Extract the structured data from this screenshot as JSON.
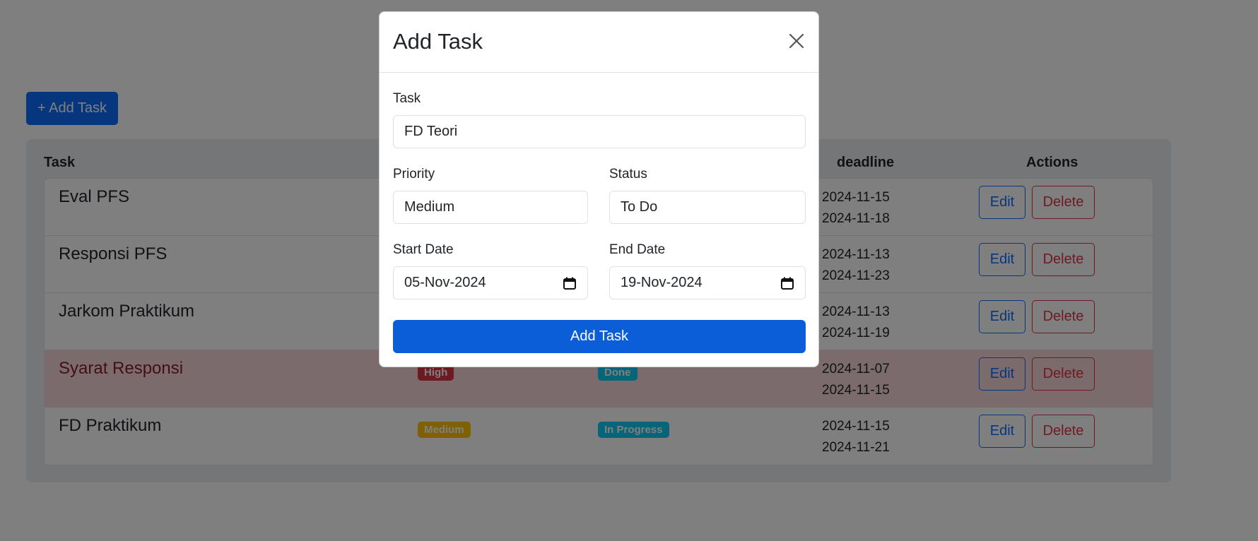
{
  "toolbar": {
    "add_task_label": "+ Add Task"
  },
  "table": {
    "columns": {
      "task": "Task",
      "deadline": "deadline",
      "actions": "Actions"
    },
    "edit_label": "Edit",
    "delete_label": "Delete",
    "rows": [
      {
        "task": "Eval PFS",
        "priority": "",
        "status": "",
        "start": "2024-11-15",
        "end": "2024-11-18"
      },
      {
        "task": "Responsi PFS",
        "priority": "",
        "status": "",
        "start": "2024-11-13",
        "end": "2024-11-23"
      },
      {
        "task": "Jarkom Praktikum",
        "priority": "",
        "status": "",
        "start": "2024-11-13",
        "end": "2024-11-19"
      },
      {
        "task": "Syarat Responsi",
        "priority": "High",
        "status": "Done",
        "start": "2024-11-07",
        "end": "2024-11-15"
      },
      {
        "task": "FD Praktikum",
        "priority": "Medium",
        "status": "In Progress",
        "start": "2024-11-15",
        "end": "2024-11-21"
      }
    ]
  },
  "modal": {
    "title": "Add Task",
    "task_label": "Task",
    "task_value": "FD Teori",
    "priority_label": "Priority",
    "priority_value": "Medium",
    "status_label": "Status",
    "status_value": "To Do",
    "start_label": "Start Date",
    "start_value": "05-Nov-2024",
    "end_label": "End Date",
    "end_value": "19-Nov-2024",
    "submit_label": "Add Task"
  },
  "colors": {
    "primary": "#0d6efd",
    "danger": "#dc3545",
    "warning": "#ffc107",
    "info": "#0dcaf0",
    "danger_row": "#f8d7da"
  },
  "icons": {
    "close": "close-icon",
    "calendar": "calendar-icon"
  }
}
